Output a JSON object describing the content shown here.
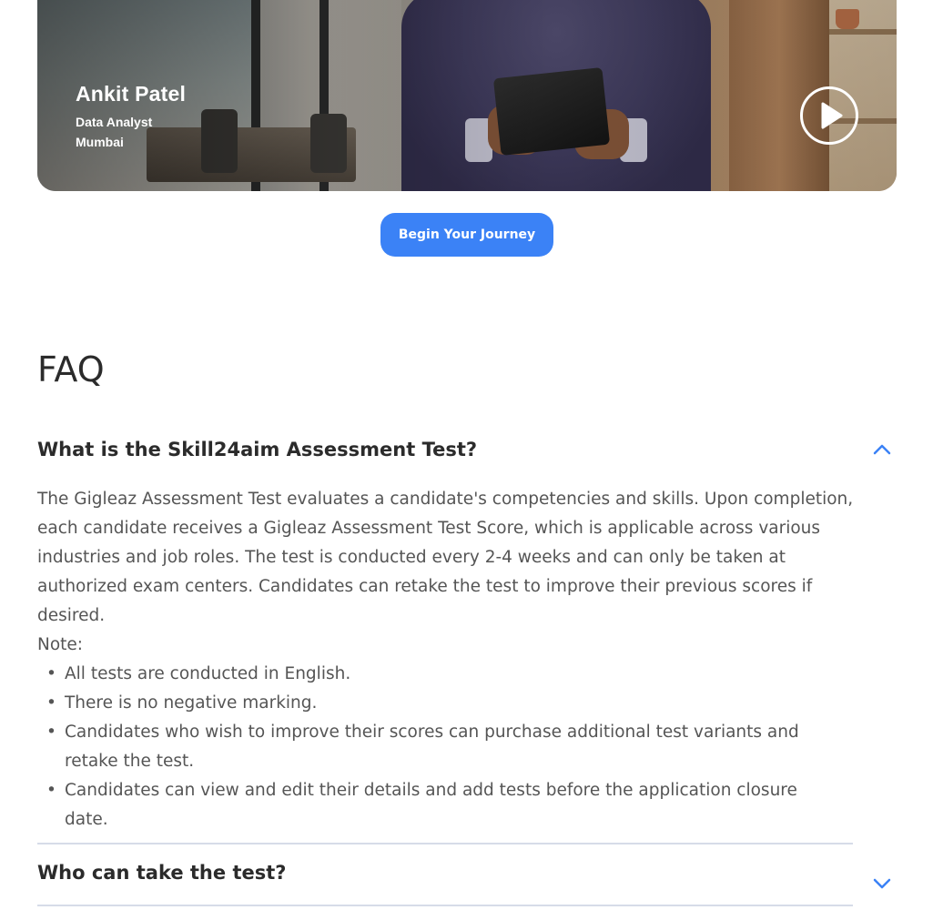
{
  "hero": {
    "name": "Ankit Patel",
    "role": "Data Analyst",
    "city": "Mumbai",
    "play_icon": "play-icon"
  },
  "cta": {
    "label": "Begin Your Journey",
    "color": "#3b82f6"
  },
  "faq": {
    "title": "FAQ",
    "items": [
      {
        "question": "What is the Skill24aim Assessment Test?",
        "expanded": true,
        "answer": "The Gigleaz Assessment Test evaluates a candidate's competencies and skills. Upon completion, each candidate receives a Gigleaz Assessment Test Score, which is applicable across various industries and job roles. The test is conducted every 2-4 weeks and can only be taken at authorized exam centers. Candidates can retake the test to improve their previous scores if desired.",
        "note_label": "Note:",
        "bullets": [
          "All tests are conducted in English.",
          "There is no negative marking.",
          "Candidates who wish to improve their scores can purchase additional test variants and retake the test.",
          "Candidates can view and edit their details and add tests before the application closure date."
        ]
      },
      {
        "question": "Who can take the test?",
        "expanded": false
      }
    ],
    "chevron_color": "#3b82f6",
    "divider_color": "#d6dce8"
  }
}
